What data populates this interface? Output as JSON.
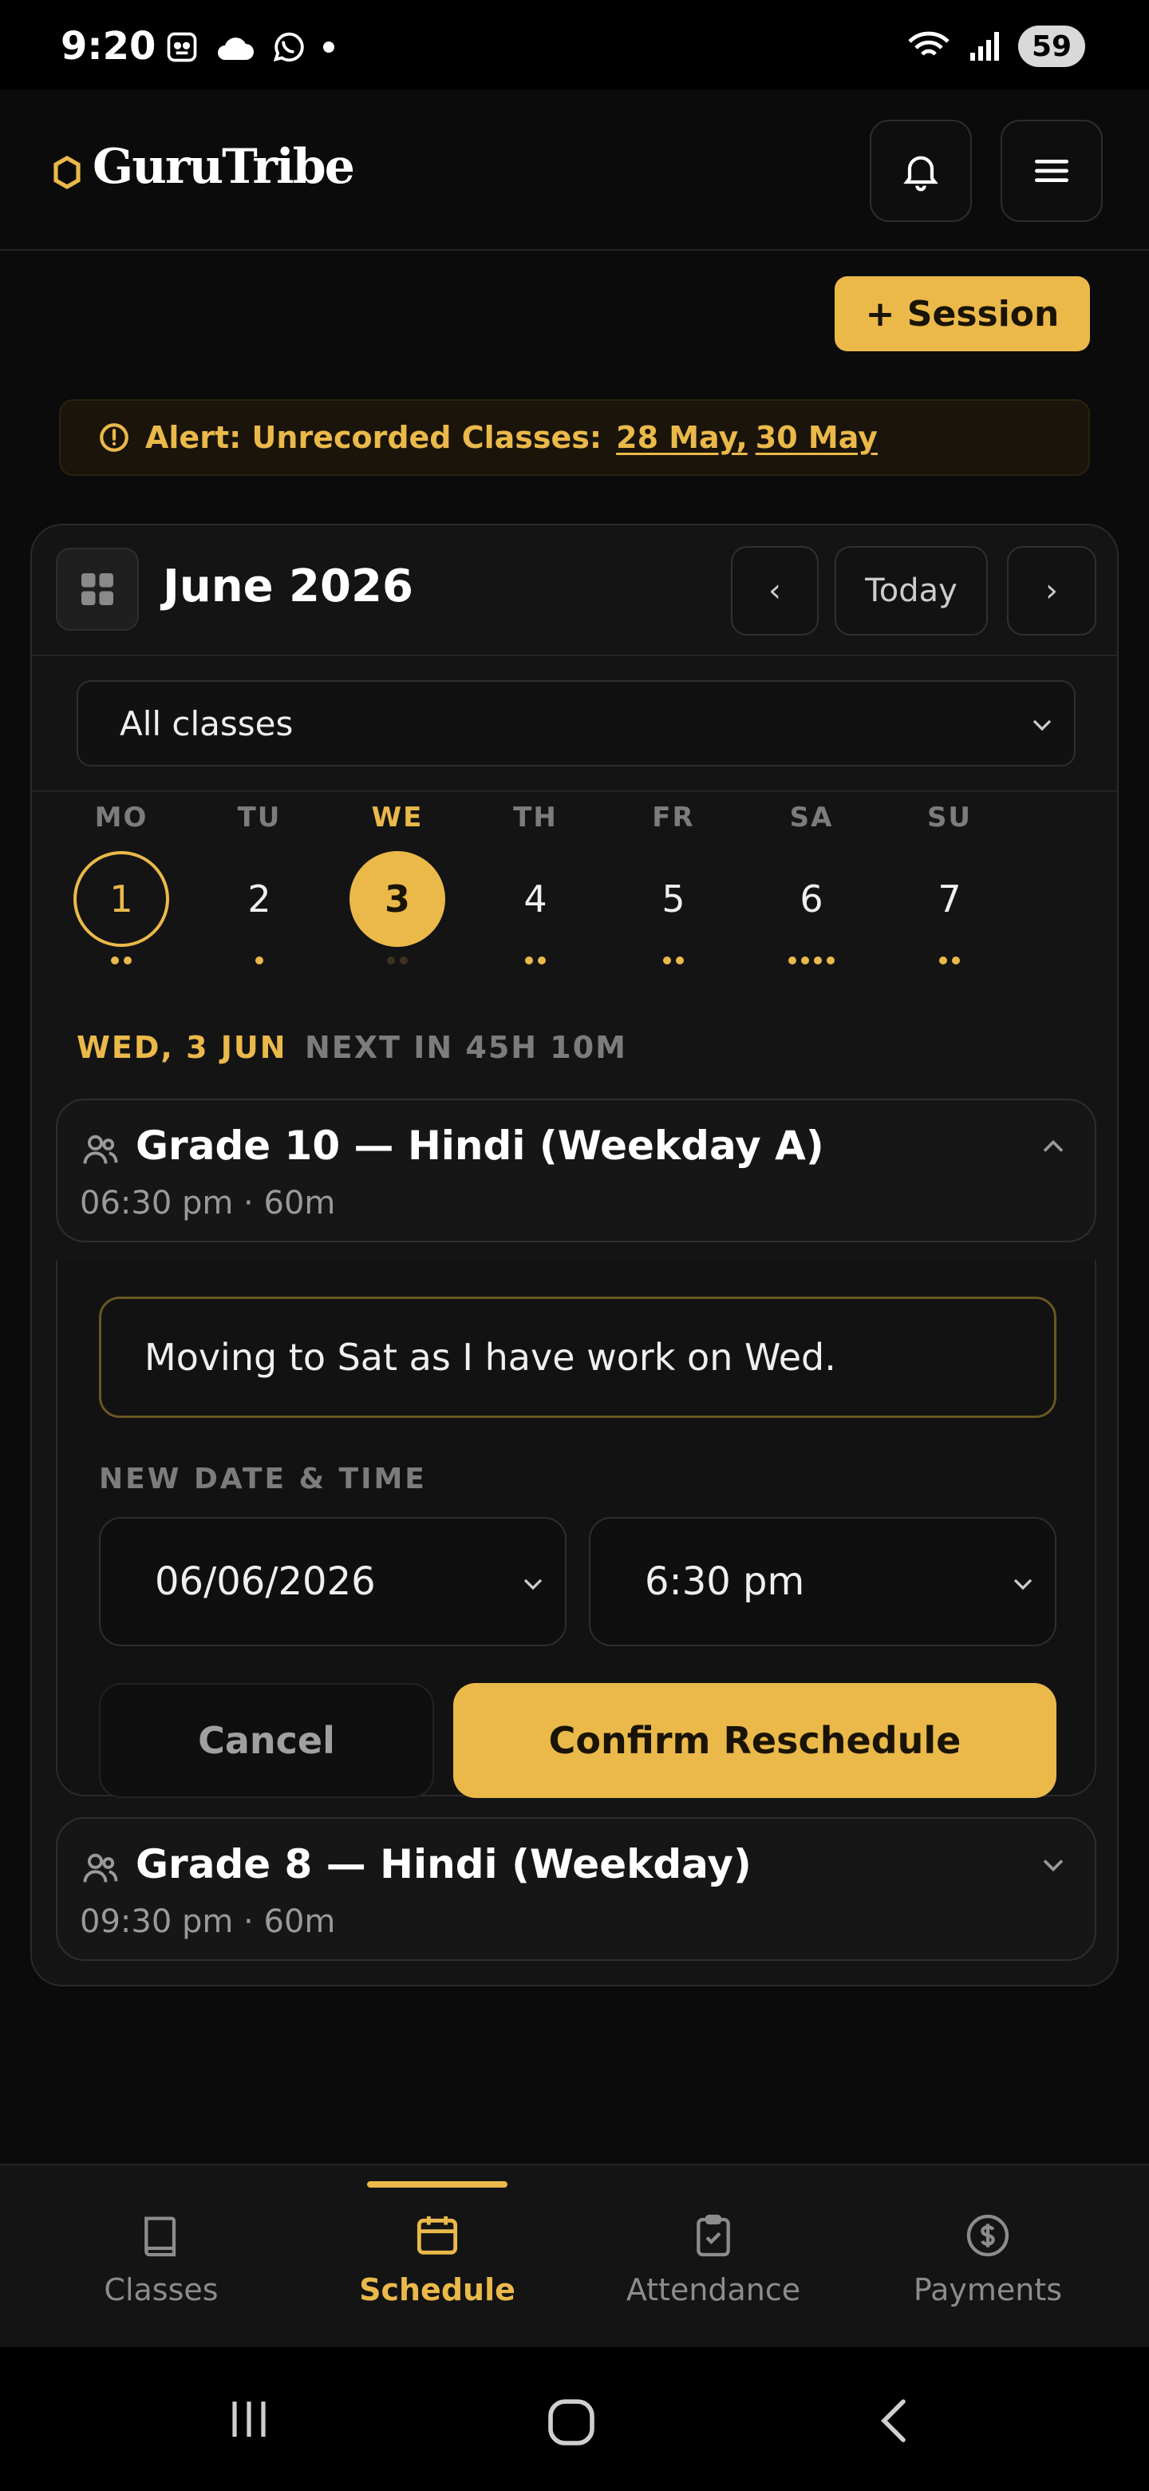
{
  "status_bar": {
    "time": "9:20",
    "battery": "59",
    "icons_left": [
      "screenshot-icon",
      "cloud-icon",
      "whatsapp-icon",
      "dot-icon"
    ],
    "icons_right": [
      "wifi-icon",
      "signal-icon",
      "battery-icon"
    ]
  },
  "header": {
    "brand": "GuruTribe",
    "accent": "#eab94a"
  },
  "actions": {
    "session_label": "+ Session"
  },
  "alert": {
    "prefix": "Alert: Unrecorded Classes:",
    "dates": [
      "28 May,",
      "30 May"
    ]
  },
  "calendar": {
    "month": "June 2026",
    "today_label": "Today",
    "prev_label": "‹",
    "next_label": "›",
    "filter_value": "All classes",
    "days": [
      {
        "dow": "MO",
        "num": "1",
        "state": "ring",
        "dots": 2
      },
      {
        "dow": "TU",
        "num": "2",
        "state": "normal",
        "dots": 1
      },
      {
        "dow": "WE",
        "num": "3",
        "state": "selected",
        "dots": 2
      },
      {
        "dow": "TH",
        "num": "4",
        "state": "normal",
        "dots": 2
      },
      {
        "dow": "FR",
        "num": "5",
        "state": "normal",
        "dots": 2
      },
      {
        "dow": "SA",
        "num": "6",
        "state": "normal",
        "dots": 4
      },
      {
        "dow": "SU",
        "num": "7",
        "state": "normal",
        "dots": 2
      }
    ],
    "selected_date": "WED, 3 JUN",
    "next_in": "NEXT IN 45H 10M"
  },
  "classes": [
    {
      "title": "Grade 10 — Hindi (Weekday A)",
      "time": "06:30 pm · 60m",
      "expanded": true
    },
    {
      "title": "Grade 8 — Hindi (Weekday)",
      "time": "09:30 pm · 60m",
      "expanded": false
    }
  ],
  "reschedule": {
    "reason": "Moving to Sat as I have work on Wed.",
    "new_label": "NEW DATE & TIME",
    "date_value": "06/06/2026",
    "time_value": "6:30 pm",
    "cancel_label": "Cancel",
    "confirm_label": "Confirm Reschedule"
  },
  "bottom_nav": [
    {
      "label": "Classes",
      "icon": "book-icon",
      "active": false
    },
    {
      "label": "Schedule",
      "icon": "calendar-icon",
      "active": true
    },
    {
      "label": "Attendance",
      "icon": "clipboard-check-icon",
      "active": false
    },
    {
      "label": "Payments",
      "icon": "dollar-circle-icon",
      "active": false
    }
  ]
}
